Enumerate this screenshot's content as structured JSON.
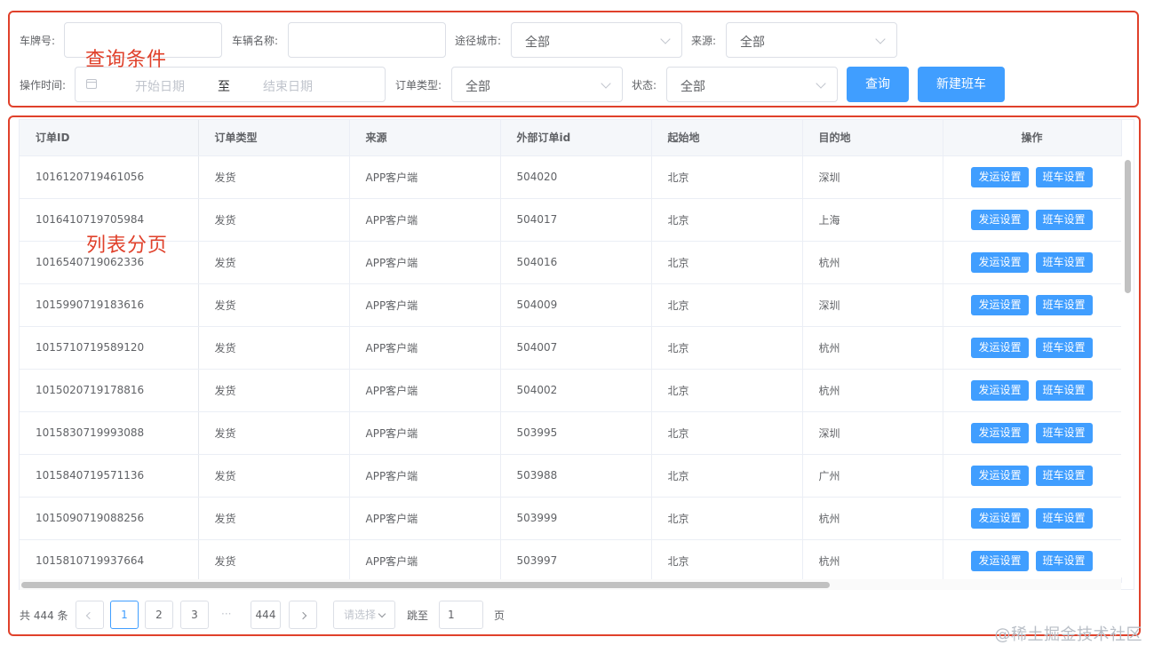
{
  "annotations": {
    "filter": "查询条件",
    "list": "列表分页"
  },
  "filters": {
    "plate_label": "车牌号:",
    "plate_value": "",
    "vehicle_name_label": "车辆名称:",
    "vehicle_name_value": "",
    "city_label": "途径城市:",
    "city_value": "全部",
    "source_label": "来源:",
    "source_value": "全部",
    "op_time_label": "操作时间:",
    "start_placeholder": "开始日期",
    "range_sep": "至",
    "end_placeholder": "结束日期",
    "order_type_label": "订单类型:",
    "order_type_value": "全部",
    "status_label": "状态:",
    "status_value": "全部",
    "query_button": "查询",
    "new_button": "新建班车"
  },
  "table": {
    "columns": [
      "订单ID",
      "订单类型",
      "来源",
      "外部订单id",
      "起始地",
      "目的地",
      "操作"
    ],
    "op_send": "发运设置",
    "op_bus": "班车设置",
    "rows": [
      [
        "1016120719461056",
        "发货",
        "APP客户端",
        "504020",
        "北京",
        "深圳"
      ],
      [
        "1016410719705984",
        "发货",
        "APP客户端",
        "504017",
        "北京",
        "上海"
      ],
      [
        "1016540719062336",
        "发货",
        "APP客户端",
        "504016",
        "北京",
        "杭州"
      ],
      [
        "1015990719183616",
        "发货",
        "APP客户端",
        "504009",
        "北京",
        "深圳"
      ],
      [
        "1015710719589120",
        "发货",
        "APP客户端",
        "504007",
        "北京",
        "杭州"
      ],
      [
        "1015020719178816",
        "发货",
        "APP客户端",
        "504002",
        "北京",
        "杭州"
      ],
      [
        "1015830719993088",
        "发货",
        "APP客户端",
        "503995",
        "北京",
        "深圳"
      ],
      [
        "1015840719571136",
        "发货",
        "APP客户端",
        "503988",
        "北京",
        "广州"
      ],
      [
        "1015090719088256",
        "发货",
        "APP客户端",
        "503999",
        "北京",
        "杭州"
      ],
      [
        "1015810719937664",
        "发货",
        "APP客户端",
        "503997",
        "北京",
        "杭州"
      ]
    ]
  },
  "pagination": {
    "total": "共 444 条",
    "pages": [
      "1",
      "2",
      "3"
    ],
    "ellipsis": "···",
    "last": "444",
    "current": "1",
    "size_placeholder": "请选择",
    "jump_label": "跳至",
    "jump_value": "1",
    "page_suffix": "页"
  },
  "watermark": "@稀土掘金技术社区",
  "colors": {
    "primary": "#409eff",
    "annotation": "#e0412b"
  }
}
